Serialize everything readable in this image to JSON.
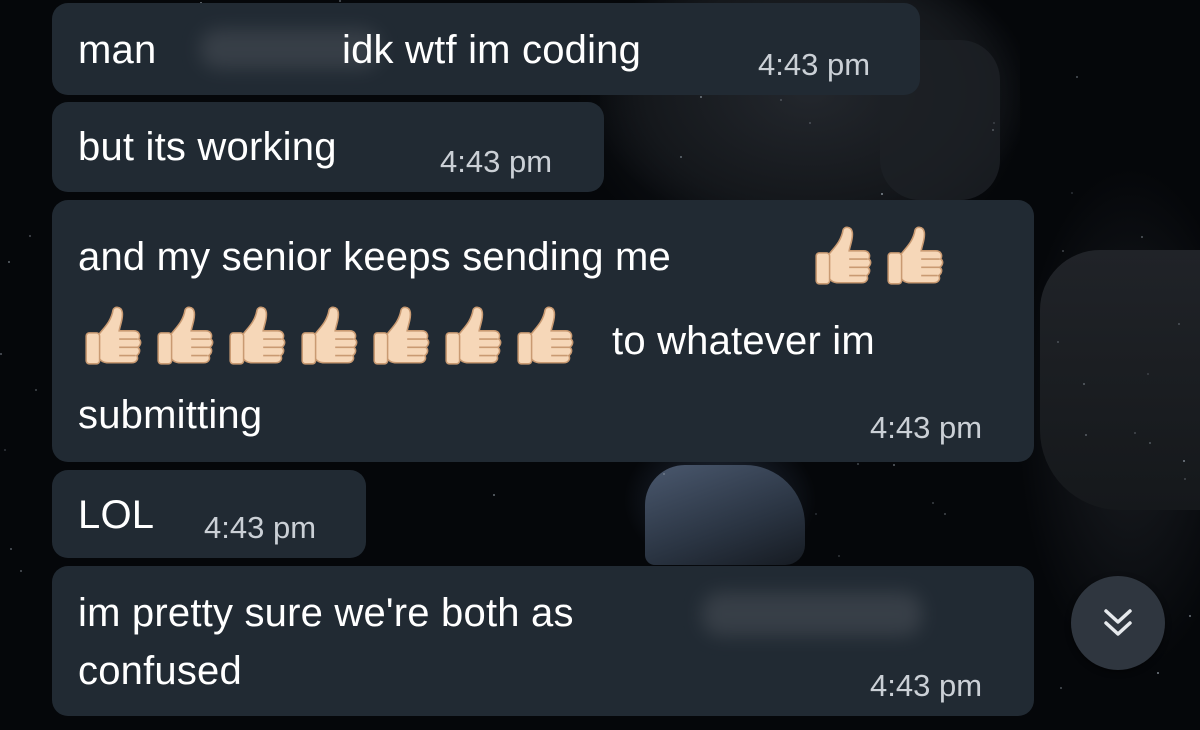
{
  "messages": [
    {
      "text_before": "man",
      "text_after": "idk wtf im coding",
      "time": "4:43 pm",
      "redacted": true
    },
    {
      "text": "but its working",
      "time": "4:43 pm"
    },
    {
      "line1": "and my senior keeps sending me",
      "line2_suffix": "to whatever im",
      "line3": "submitting",
      "time": "4:43 pm",
      "emoji": "thumbs-up",
      "emoji_count": 9
    },
    {
      "text": "LOL",
      "time": "4:43 pm"
    },
    {
      "line1": "im pretty sure we're both as",
      "line2": "confused",
      "time": "4:43 pm",
      "redacted": true
    }
  ],
  "scroll_button": {
    "icon": "double-chevron-down-icon"
  },
  "colors": {
    "bubble": "#212a33",
    "text": "#ffffff",
    "timestamp": "#cbd0d6",
    "background": "#05070a"
  }
}
